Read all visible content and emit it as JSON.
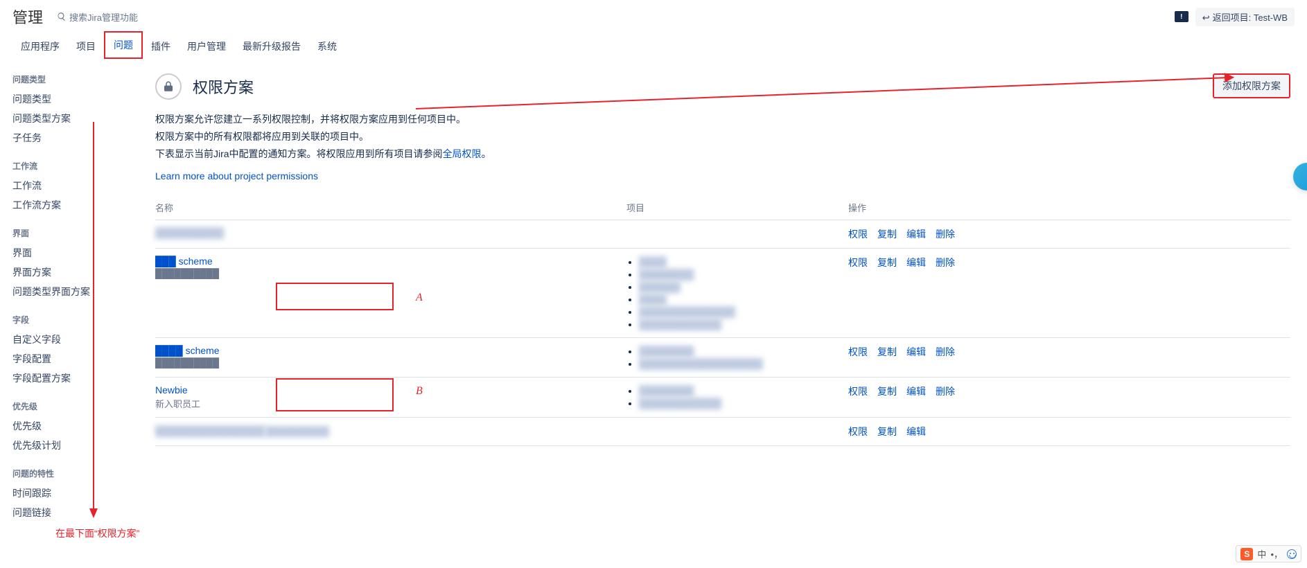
{
  "header": {
    "title": "管理",
    "search_placeholder": "搜索Jira管理功能",
    "return_label": "返回项目: Test-WB"
  },
  "nav": {
    "items": [
      "应用程序",
      "项目",
      "问题",
      "插件",
      "用户管理",
      "最新升级报告",
      "系统"
    ],
    "active_index": 2
  },
  "sidebar": {
    "groups": [
      {
        "heading": "问题类型",
        "items": [
          "问题类型",
          "问题类型方案",
          "子任务"
        ]
      },
      {
        "heading": "工作流",
        "items": [
          "工作流",
          "工作流方案"
        ]
      },
      {
        "heading": "界面",
        "items": [
          "界面",
          "界面方案",
          "问题类型界面方案"
        ]
      },
      {
        "heading": "字段",
        "items": [
          "自定义字段",
          "字段配置",
          "字段配置方案"
        ]
      },
      {
        "heading": "优先级",
        "items": [
          "优先级",
          "优先级计划"
        ]
      },
      {
        "heading": "问题的特性",
        "items": [
          "时间跟踪",
          "问题链接"
        ]
      }
    ]
  },
  "page": {
    "title": "权限方案",
    "add_button": "添加权限方案",
    "desc_line1": "权限方案允许您建立一系列权限控制，并将权限方案应用到任何项目中。",
    "desc_line2": "权限方案中的所有权限都将应用到关联的项目中。",
    "desc_line3a": "下表显示当前Jira中配置的通知方案。将权限应用到所有项目请参阅",
    "desc_line3_link": "全局权限",
    "desc_line3b": "。",
    "learn_more": "Learn more about project permissions"
  },
  "table": {
    "col_name": "名称",
    "col_project": "项目",
    "col_action": "操作",
    "actions": {
      "perm": "权限",
      "copy": "复制",
      "edit": "编辑",
      "del": "删除"
    },
    "rows": [
      {
        "name": "██████████",
        "sub": "",
        "name_redacted": true,
        "projects": [],
        "show_delete": true
      },
      {
        "name": "███ scheme",
        "sub": "██████████",
        "name_redacted": false,
        "projects": [
          "████",
          "████████",
          "██████",
          "████",
          "██████████████",
          "████████████"
        ],
        "show_delete": true
      },
      {
        "name": "████ scheme",
        "sub": "██████████",
        "name_redacted": false,
        "projects": [
          "████████",
          "██████████████████"
        ],
        "show_delete": true
      },
      {
        "name": "Newbie",
        "sub": "新入职员工",
        "name_redacted": false,
        "projects": [
          "████████",
          "████████████"
        ],
        "show_delete": true
      },
      {
        "name": "████████████████",
        "sub": "██████████",
        "name_redacted": true,
        "projects": [],
        "show_delete": false
      }
    ]
  },
  "annotations": {
    "label_a": "A",
    "label_b": "B",
    "bottom_note": "在最下面“权限方案”"
  },
  "ime": {
    "lang": "中",
    "punct": "•，"
  }
}
